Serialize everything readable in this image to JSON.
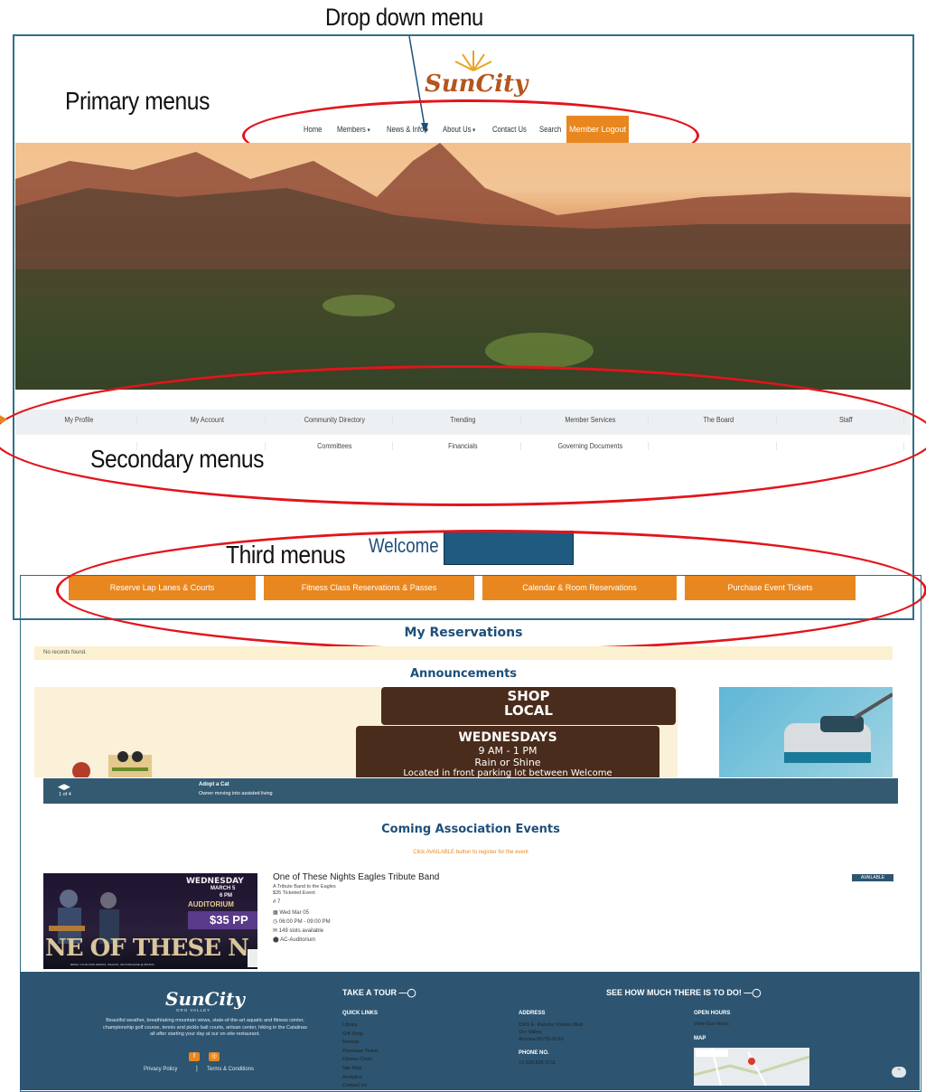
{
  "annotations": {
    "dropdown": "Drop down menu",
    "primary": "Primary menus",
    "secondary": "Secondary menus",
    "third": "Third menus"
  },
  "brand": {
    "logo": "SunCity",
    "sub": "ORO VALLEY"
  },
  "nav": {
    "home": "Home",
    "members": "Members",
    "news": "News & Info",
    "about": "About Us",
    "contact": "Contact Us",
    "search": "Search",
    "logout": "Member Logout"
  },
  "secondary": {
    "row1": [
      "My Profile",
      "My Account",
      "Community Directory",
      "Trending",
      "Member Services",
      "The Board",
      "Staff"
    ],
    "row2": [
      "",
      "",
      "Committees",
      "Financials",
      "Governing Documents",
      "",
      ""
    ]
  },
  "welcome": "Welcome",
  "third": [
    "Reserve Lap Lanes & Courts",
    "Fitness Class Reservations & Passes",
    "Calendar & Room Reservations",
    "Purchase Event Tickets"
  ],
  "reservations": {
    "title": "My Reservations",
    "empty": "No records found."
  },
  "announcements": {
    "title": "Announcements",
    "flyer": {
      "shop": "SHOP",
      "local": "LOCAL",
      "day": "WEDNESDAYS",
      "time": "9 AM - 1 PM",
      "weather": "Rain or Shine",
      "where": "Located in front parking lot between Welcome"
    },
    "pager": "1 of 4",
    "item_title": "Adopt a Cat",
    "item_desc": "Owner moving into assisted living"
  },
  "events": {
    "title": "Coming Association Events",
    "hint": "Click AVAILABLE button to register for the event",
    "event": {
      "name": "One of These Nights Eagles Tribute Band",
      "desc1": "A Tribute Band to the Eagles",
      "desc2": "$35 Ticketed Event",
      "number": "7",
      "date": "Wed Mar 05",
      "time": "06:00 PM - 09:00 PM",
      "slots": "149 slots available",
      "location": "AC-Auditorium",
      "badge": "AVAILABLE",
      "poster": {
        "day": "WEDNESDAY",
        "date": "MARCH 5",
        "time": "6 PM",
        "venue": "AUDITORIUM",
        "price": "$35 PP",
        "band": "NE OF THESE N",
        "note": "BRING YOUR OWN DRINKS, SNACKS, OR PURCHASE @ BISTRO"
      }
    }
  },
  "footer": {
    "logo": "SunCity",
    "sub": "ORO VALLEY",
    "about": "Beautiful weather, breathtaking mountain views, state-of-the-art aquatic and fitness center, championship golf course, tennis and pickle ball courts, artisan center, hiking in the Catalinas all after starting your day at our on-site restaurant.",
    "privacy": "Privacy Policy",
    "sep": "|",
    "terms": "Terms & Conditions",
    "tour": "TAKE A TOUR",
    "more": "SEE HOW MUCH THERE IS TO DO!",
    "quick_title": "QUICK LINKS",
    "quick": [
      "Library",
      "Gift Shop",
      "Rentals",
      "Purchase Ticket",
      "Fitness Class",
      "Site Map",
      "Analytics",
      "Contact Us"
    ],
    "address_title": "ADDRESS",
    "address": [
      "1565 E. Rancho Vistoso Blvd.",
      "Oro Valley,",
      "Arizona 85755-9120"
    ],
    "phone_title": "PHONE NO.",
    "phone": "+1 520 825 3711",
    "hours_title": "OPEN HOURS",
    "hours": "View Our Hours",
    "map_title": "MAP"
  }
}
